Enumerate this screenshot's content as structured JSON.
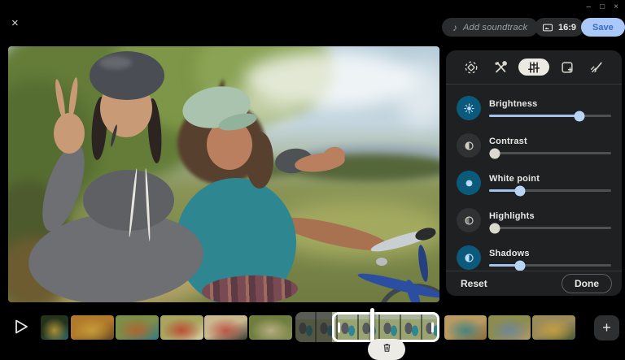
{
  "window": {
    "minimize_glyph": "–",
    "maximize_glyph": "□",
    "close_glyph": "×"
  },
  "topbar": {
    "close_glyph": "×",
    "music_note_glyph": "♪",
    "add_soundtrack_label": "Add soundtrack",
    "aspect_label": "16:9",
    "save_label": "Save"
  },
  "preview": {
    "alt": "Two smiling friends wearing bike helmets, one making a peace sign, with a blue bicycle in a sunny park"
  },
  "panel": {
    "tabs": [
      {
        "name": "crop-rotate",
        "active": false
      },
      {
        "name": "tools",
        "active": false
      },
      {
        "name": "adjust",
        "active": true
      },
      {
        "name": "filters",
        "active": false
      },
      {
        "name": "markup",
        "active": false
      }
    ],
    "sliders": [
      {
        "label": "Brightness",
        "value": 74,
        "active": true
      },
      {
        "label": "Contrast",
        "value": 0,
        "active": false
      },
      {
        "label": "White point",
        "value": 25,
        "active": true
      },
      {
        "label": "Highlights",
        "value": 0,
        "active": false
      },
      {
        "label": "Shadows",
        "value": 25,
        "active": true
      }
    ],
    "reset_label": "Reset",
    "done_label": "Done"
  },
  "filmstrip": {
    "plus_glyph": "+",
    "thumbs": [
      {
        "name": "clip-couple-garden",
        "palette": [
          "#24331c",
          "#caa43c",
          "#2e6b63"
        ]
      },
      {
        "name": "clip-hands-on-face",
        "palette": [
          "#b07a2a",
          "#caa43c",
          "#6b4a26"
        ]
      },
      {
        "name": "clip-group-bikes",
        "palette": [
          "#7d8d4a",
          "#b85c2e",
          "#2e7d86"
        ]
      },
      {
        "name": "clip-flower-field",
        "palette": [
          "#a8a55e",
          "#c0392b",
          "#d8cfa8"
        ]
      },
      {
        "name": "clip-red-sweater-pair",
        "palette": [
          "#cbb78e",
          "#b8443a",
          "#3c3c34"
        ]
      },
      {
        "name": "clip-picnic",
        "palette": [
          "#6f7e3f",
          "#c8b890",
          "#8a9156"
        ]
      },
      {
        "name": "clip-selected-bike-couple",
        "palette": [
          "#9aa472",
          "#2e8691",
          "#565a5e"
        ],
        "selected": true
      },
      {
        "name": "clip-bike-path",
        "palette": [
          "#b99a62",
          "#2e7d86",
          "#8a6a3a"
        ]
      },
      {
        "name": "clip-denim-grass",
        "palette": [
          "#8c8c50",
          "#6a84a8",
          "#b09a6a"
        ]
      },
      {
        "name": "clip-group-sitting",
        "palette": [
          "#9c8a5a",
          "#caa43c",
          "#4a5a33"
        ]
      }
    ]
  },
  "colors": {
    "active_icon_bg": "#0b5a7c",
    "active_glyph": "#bcdcf5",
    "inactive_icon_bg": "#2f3133",
    "inactive_glyph": "#cfccc2",
    "slider_fill": "#a5c2ee",
    "slider_thumb_active": "#b8d4f5",
    "slider_thumb_inactive": "#dcd9cd",
    "slider_track": "#4e5052",
    "save_bg": "#aac8f8",
    "save_text": "#3a6bc4",
    "panel_bg": "#1f2021",
    "pill_bg": "#2a2b2c"
  }
}
